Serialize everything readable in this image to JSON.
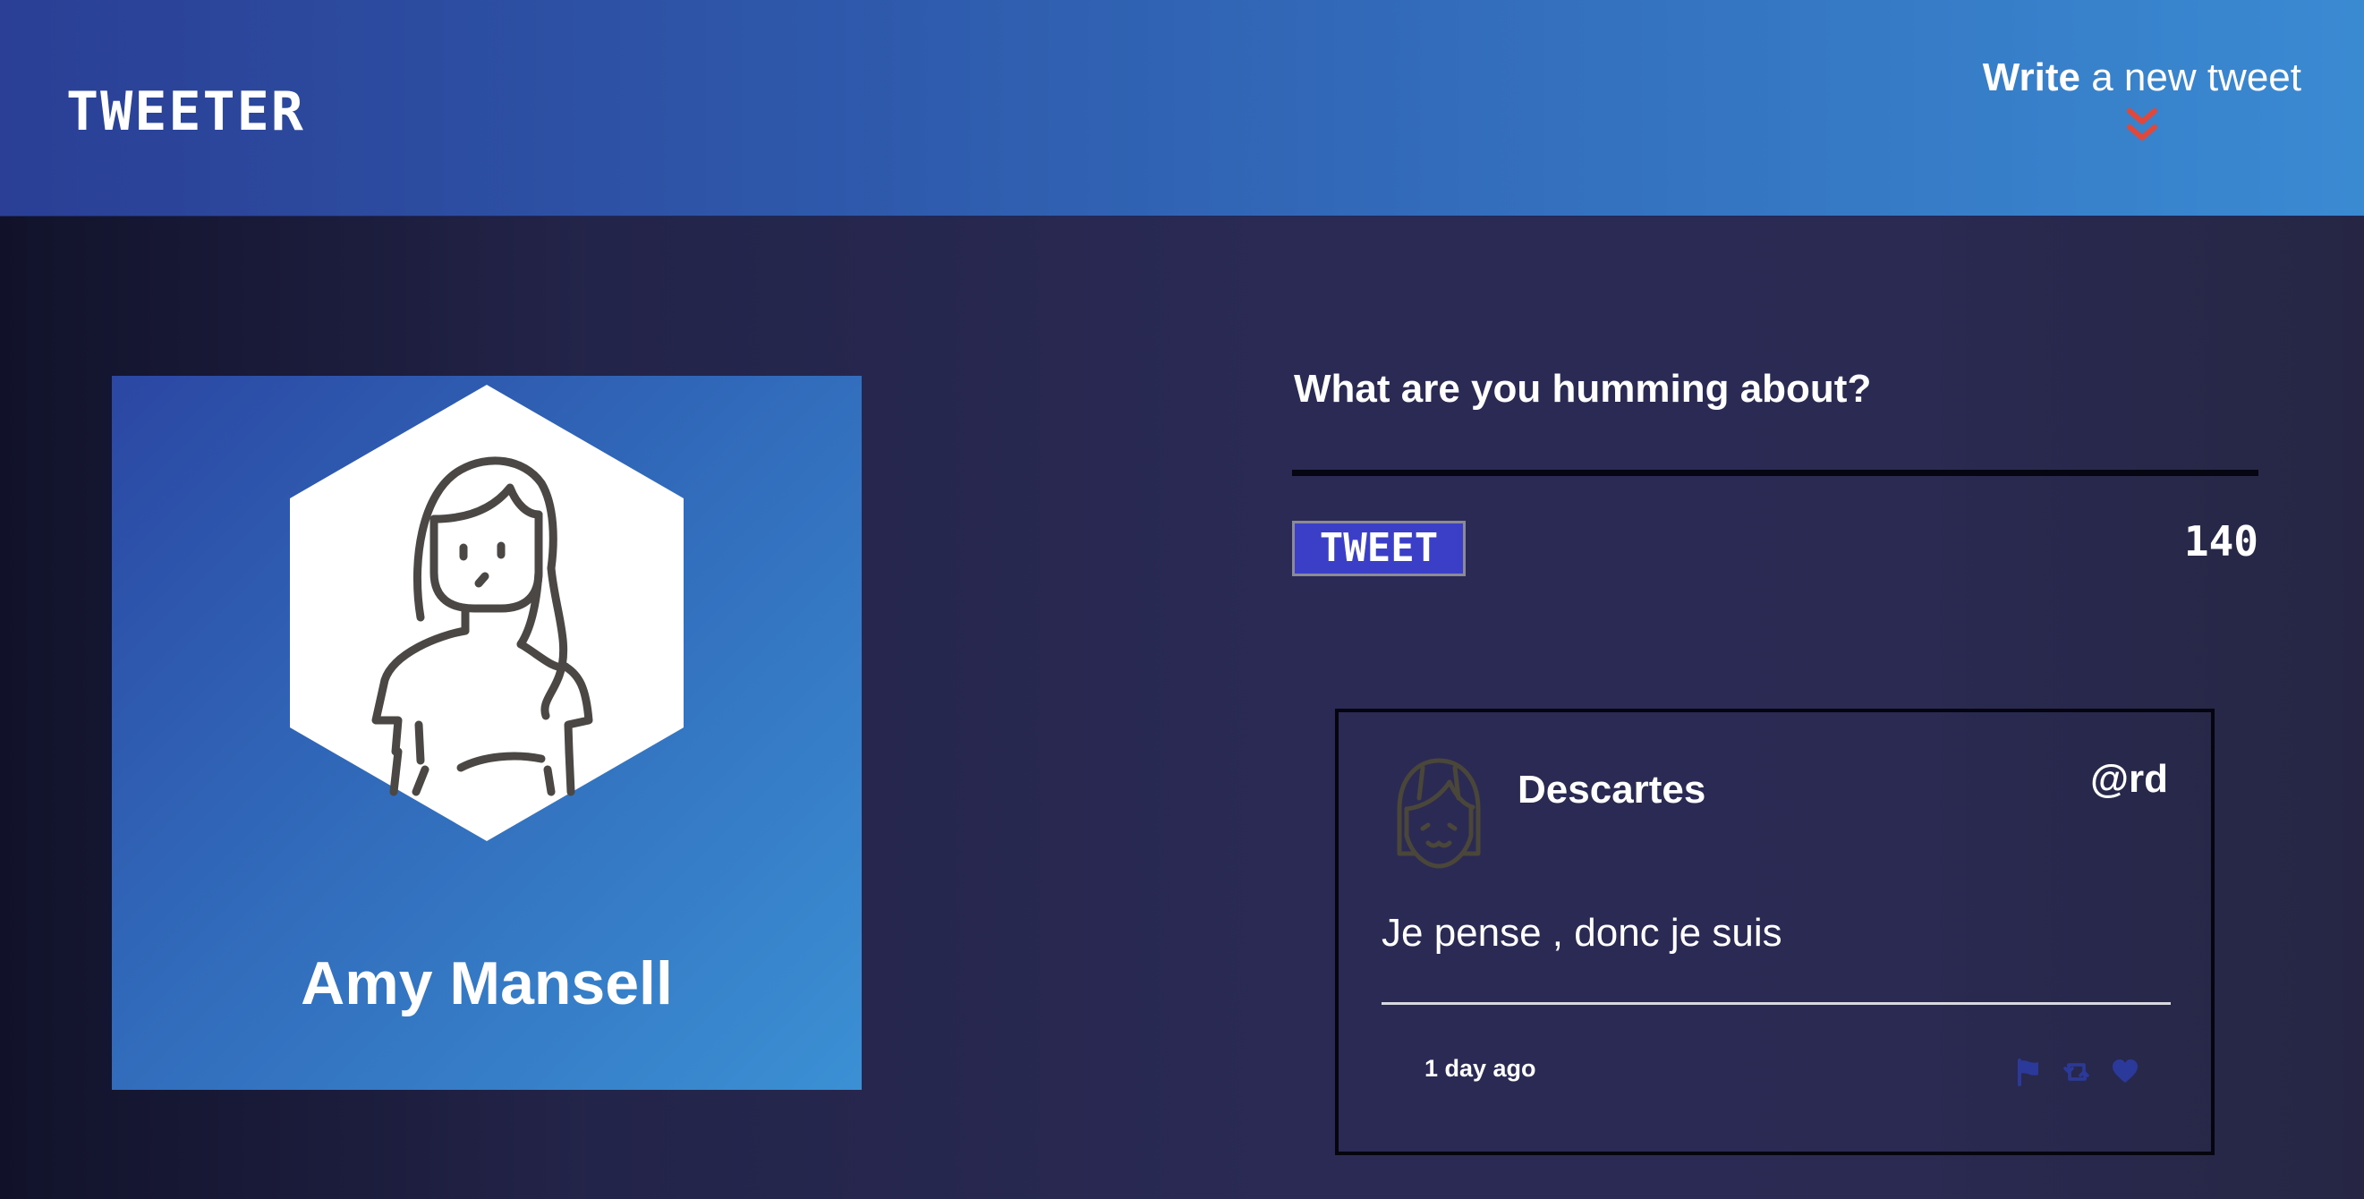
{
  "nav": {
    "logo": "TWEETER",
    "compose_bold": "Write",
    "compose_rest": " a new tweet",
    "toggle_icon": "double-chevron-down-icon",
    "toggle_color": "#e0483c"
  },
  "profile": {
    "name": "Amy Mansell",
    "avatar_icon": "woman-avatar-icon"
  },
  "compose": {
    "placeholder": "What are you humming about?",
    "button_label": "TWEET",
    "counter": "140"
  },
  "tweet": {
    "author": "Descartes",
    "handle": "@rd",
    "text": "Je pense , donc je suis",
    "time": "1 day ago",
    "avatar_icon": "girl-avatar-icon",
    "actions": [
      "flag-icon",
      "retweet-icon",
      "heart-icon"
    ],
    "action_color": "#2b3a9a"
  },
  "colors": {
    "nav_start": "#2a3f95",
    "nav_end": "#3a8ad2",
    "button": "#3b3fc8",
    "background": "#2a2a55"
  }
}
